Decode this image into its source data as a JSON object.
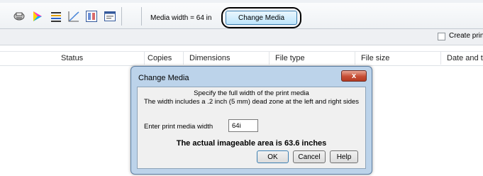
{
  "toolbar": {
    "icons": [
      "printer-icon",
      "color-icon",
      "align-icon",
      "curve-icon",
      "layout-icon",
      "window-icon"
    ],
    "media_width_label": "Media width = 64 in",
    "change_media_label": "Change Media"
  },
  "options_bar": {
    "create_checkbox_label": "Create prin",
    "create_checked": false
  },
  "table": {
    "columns": [
      "Status",
      "Copies",
      "Dimensions",
      "File type",
      "File size",
      "Date and ti"
    ]
  },
  "dialog": {
    "title": "Change Media",
    "close_label": "x",
    "instruction_1": "Specify the full width of the print media",
    "instruction_2": "The width includes a .2 inch (5 mm) dead zone at the left and right sides",
    "field_label": "Enter print media width",
    "field_value": "64i",
    "actual_area": "The actual imageable area is 63.6 inches",
    "ok_label": "OK",
    "cancel_label": "Cancel",
    "help_label": "Help"
  },
  "colors": {
    "dialog_frame": "#bcd3ea",
    "close_button": "#c74e35",
    "button_highlight": "#bee6fd"
  }
}
